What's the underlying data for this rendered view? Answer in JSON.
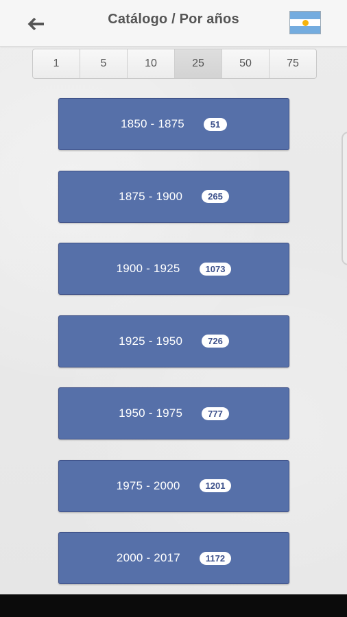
{
  "header": {
    "title": "Catálogo / Por años",
    "back_icon": "arrow-left-icon",
    "flag_icon": "argentina-flag-icon"
  },
  "segments": {
    "items": [
      "1",
      "5",
      "10",
      "25",
      "50",
      "75"
    ],
    "selected": "25"
  },
  "periods": [
    {
      "range": "1850 - 1875",
      "count": "51"
    },
    {
      "range": "1875 - 1900",
      "count": "265"
    },
    {
      "range": "1900 - 1925",
      "count": "1073"
    },
    {
      "range": "1925 - 1950",
      "count": "726"
    },
    {
      "range": "1950 - 1975",
      "count": "777"
    },
    {
      "range": "1975 - 2000",
      "count": "1201"
    },
    {
      "range": "2000 - 2017",
      "count": "1172"
    }
  ],
  "colors": {
    "button_blue": "#5670a9",
    "badge_text": "#3b4f8a",
    "header_bg": "#f6f6f6",
    "flag_blue": "#74acdf",
    "flag_sun": "#f6b40e"
  }
}
